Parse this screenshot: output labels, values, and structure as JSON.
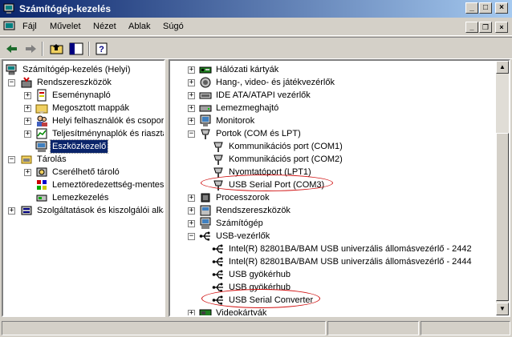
{
  "window": {
    "title": "Számítógép-kezelés"
  },
  "menu": {
    "items": [
      "Fájl",
      "Művelet",
      "Nézet",
      "Ablak",
      "Súgó"
    ]
  },
  "left_tree": [
    {
      "label": "Számítógép-kezelés (Helyi)",
      "icon": "computer-management-icon",
      "expander": "",
      "selected": false
    },
    {
      "label": "Rendszereszközök",
      "icon": "system-tools-icon",
      "expander": "−",
      "selected": false
    },
    {
      "label": "Eseménynapló",
      "icon": "event-viewer-icon",
      "expander": "+",
      "selected": false
    },
    {
      "label": "Megosztott mappák",
      "icon": "shared-folders-icon",
      "expander": "+",
      "selected": false
    },
    {
      "label": "Helyi felhasználók és csoport",
      "icon": "users-icon",
      "expander": "+",
      "selected": false
    },
    {
      "label": "Teljesítménynaplók és riasztá",
      "icon": "performance-logs-icon",
      "expander": "+",
      "selected": false
    },
    {
      "label": "Eszközkezelő",
      "icon": "device-manager-icon",
      "expander": "",
      "selected": true
    },
    {
      "label": "Tárolás",
      "icon": "storage-icon",
      "expander": "−",
      "selected": false
    },
    {
      "label": "Cserélhető tároló",
      "icon": "removable-storage-icon",
      "expander": "+",
      "selected": false
    },
    {
      "label": "Lemeztöredezettség-mentes",
      "icon": "defrag-icon",
      "expander": "",
      "selected": false
    },
    {
      "label": "Lemezkezelés",
      "icon": "disk-management-icon",
      "expander": "",
      "selected": false
    },
    {
      "label": "Szolgáltatások és kiszolgálói alkal",
      "icon": "services-icon",
      "expander": "+",
      "selected": false
    }
  ],
  "right_tree": [
    {
      "label": "Hálózati kártyák",
      "icon": "network-card-icon",
      "expander": "+"
    },
    {
      "label": "Hang-, video- és játékvezérlők",
      "icon": "sound-icon",
      "expander": "+"
    },
    {
      "label": "IDE ATA/ATAPI vezérlők",
      "icon": "ide-controller-icon",
      "expander": "+"
    },
    {
      "label": "Lemezmeghajtó",
      "icon": "disk-drive-icon",
      "expander": "+"
    },
    {
      "label": "Monitorok",
      "icon": "monitor-icon",
      "expander": "+"
    },
    {
      "label": "Portok (COM és LPT)",
      "icon": "port-icon",
      "expander": "−"
    },
    {
      "label": "Kommunikációs port (COM1)",
      "icon": "port-icon",
      "expander": ""
    },
    {
      "label": "Kommunikációs port (COM2)",
      "icon": "port-icon",
      "expander": ""
    },
    {
      "label": "Nyomtatóport (LPT1)",
      "icon": "port-icon",
      "expander": ""
    },
    {
      "label": "USB Serial Port (COM3)",
      "icon": "port-icon",
      "expander": ""
    },
    {
      "label": "Processzorok",
      "icon": "processor-icon",
      "expander": "+"
    },
    {
      "label": "Rendszereszközök",
      "icon": "system-devices-icon",
      "expander": "+"
    },
    {
      "label": "Számítógép",
      "icon": "computer-icon",
      "expander": "+"
    },
    {
      "label": "USB-vezérlők",
      "icon": "usb-icon",
      "expander": "−"
    },
    {
      "label": "Intel(R) 82801BA/BAM USB univerzális állomásvezérlő - 2442",
      "icon": "usb-icon",
      "expander": ""
    },
    {
      "label": "Intel(R) 82801BA/BAM USB univerzális állomásvezérlő - 2444",
      "icon": "usb-icon",
      "expander": ""
    },
    {
      "label": "USB gyökérhub",
      "icon": "usb-icon",
      "expander": ""
    },
    {
      "label": "USB gyökérhub",
      "icon": "usb-icon",
      "expander": ""
    },
    {
      "label": "USB Serial Converter",
      "icon": "usb-icon",
      "expander": ""
    },
    {
      "label": "Videokártyák",
      "icon": "display-adapter-icon",
      "expander": "+"
    }
  ],
  "colors": {
    "title_start": "#0a246a",
    "title_end": "#a6caf0",
    "selection": "#0a246a",
    "highlight_oval": "#d01010"
  }
}
